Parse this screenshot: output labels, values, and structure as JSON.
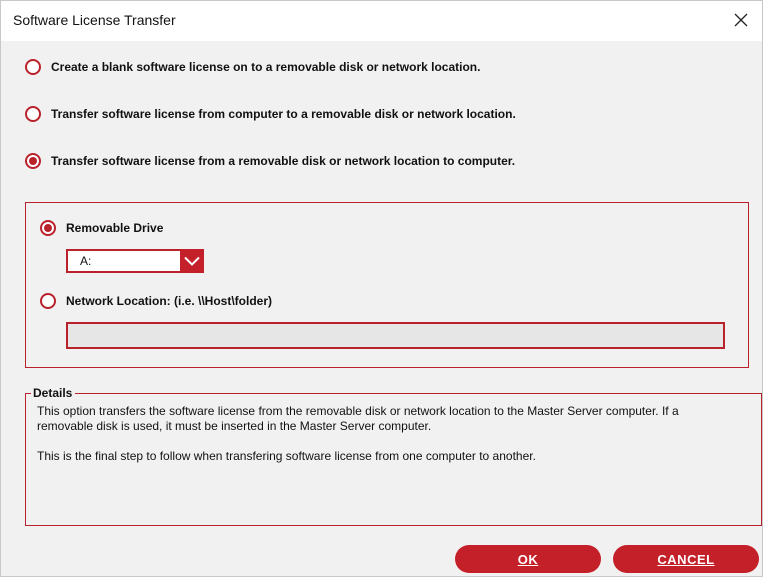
{
  "window": {
    "title": "Software License Transfer"
  },
  "options": [
    {
      "label": "Create a blank software license on to a removable disk or network location.",
      "checked": false
    },
    {
      "label": "Transfer software license from computer to a removable disk or network location.",
      "checked": false
    },
    {
      "label": "Transfer software license from a removable disk or network location to computer.",
      "checked": true
    }
  ],
  "location": {
    "removable_label": "Removable Drive",
    "removable_checked": true,
    "drive_value": "A:",
    "network_label": "Network Location: (i.e. \\\\Host\\folder)",
    "network_checked": false,
    "network_value": ""
  },
  "details": {
    "title": "Details",
    "paragraph1": "This option transfers the software license from the removable disk or network location to the Master Server computer.  If a removable disk is used, it must be inserted in the Master Server computer.",
    "paragraph2": "This is the final step to follow when transfering software license from one computer to another."
  },
  "buttons": {
    "ok_label": "OK",
    "cancel_label": "CANCEL"
  },
  "colors": {
    "accent": "#c4202a",
    "window_bg": "#f1f1f1",
    "field_bg": "#e6e6e6"
  },
  "icons": {
    "close": "close-icon",
    "dropdown": "chevron-down-icon"
  }
}
